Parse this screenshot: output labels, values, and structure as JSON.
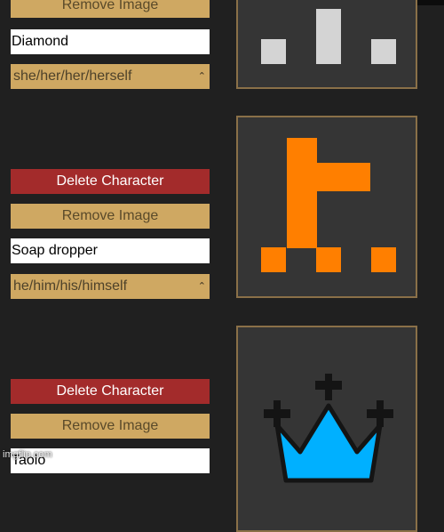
{
  "characters": [
    {
      "remove_label": "Remove Image",
      "name": "Diamond",
      "pronouns": "she/her/her/herself",
      "icon": "diamond-pixel-icon",
      "icon_color": "#d4d4d4"
    },
    {
      "delete_label": "Delete Character",
      "remove_label": "Remove Image",
      "name": "Soap dropper",
      "pronouns": "he/him/his/himself",
      "icon": "soap-dropper-pixel-icon",
      "icon_color": "#ff7f00"
    },
    {
      "delete_label": "Delete Character",
      "remove_label": "Remove Image",
      "name": "Taolo",
      "icon": "crown-icon",
      "icon_color": "#00b0ff"
    }
  ],
  "colors": {
    "background": "#202020",
    "delete": "#a32b2b",
    "remove": "#cfa862",
    "portrait_bg": "#353535",
    "portrait_border": "#8a7048"
  },
  "watermark": "imgflip.com"
}
